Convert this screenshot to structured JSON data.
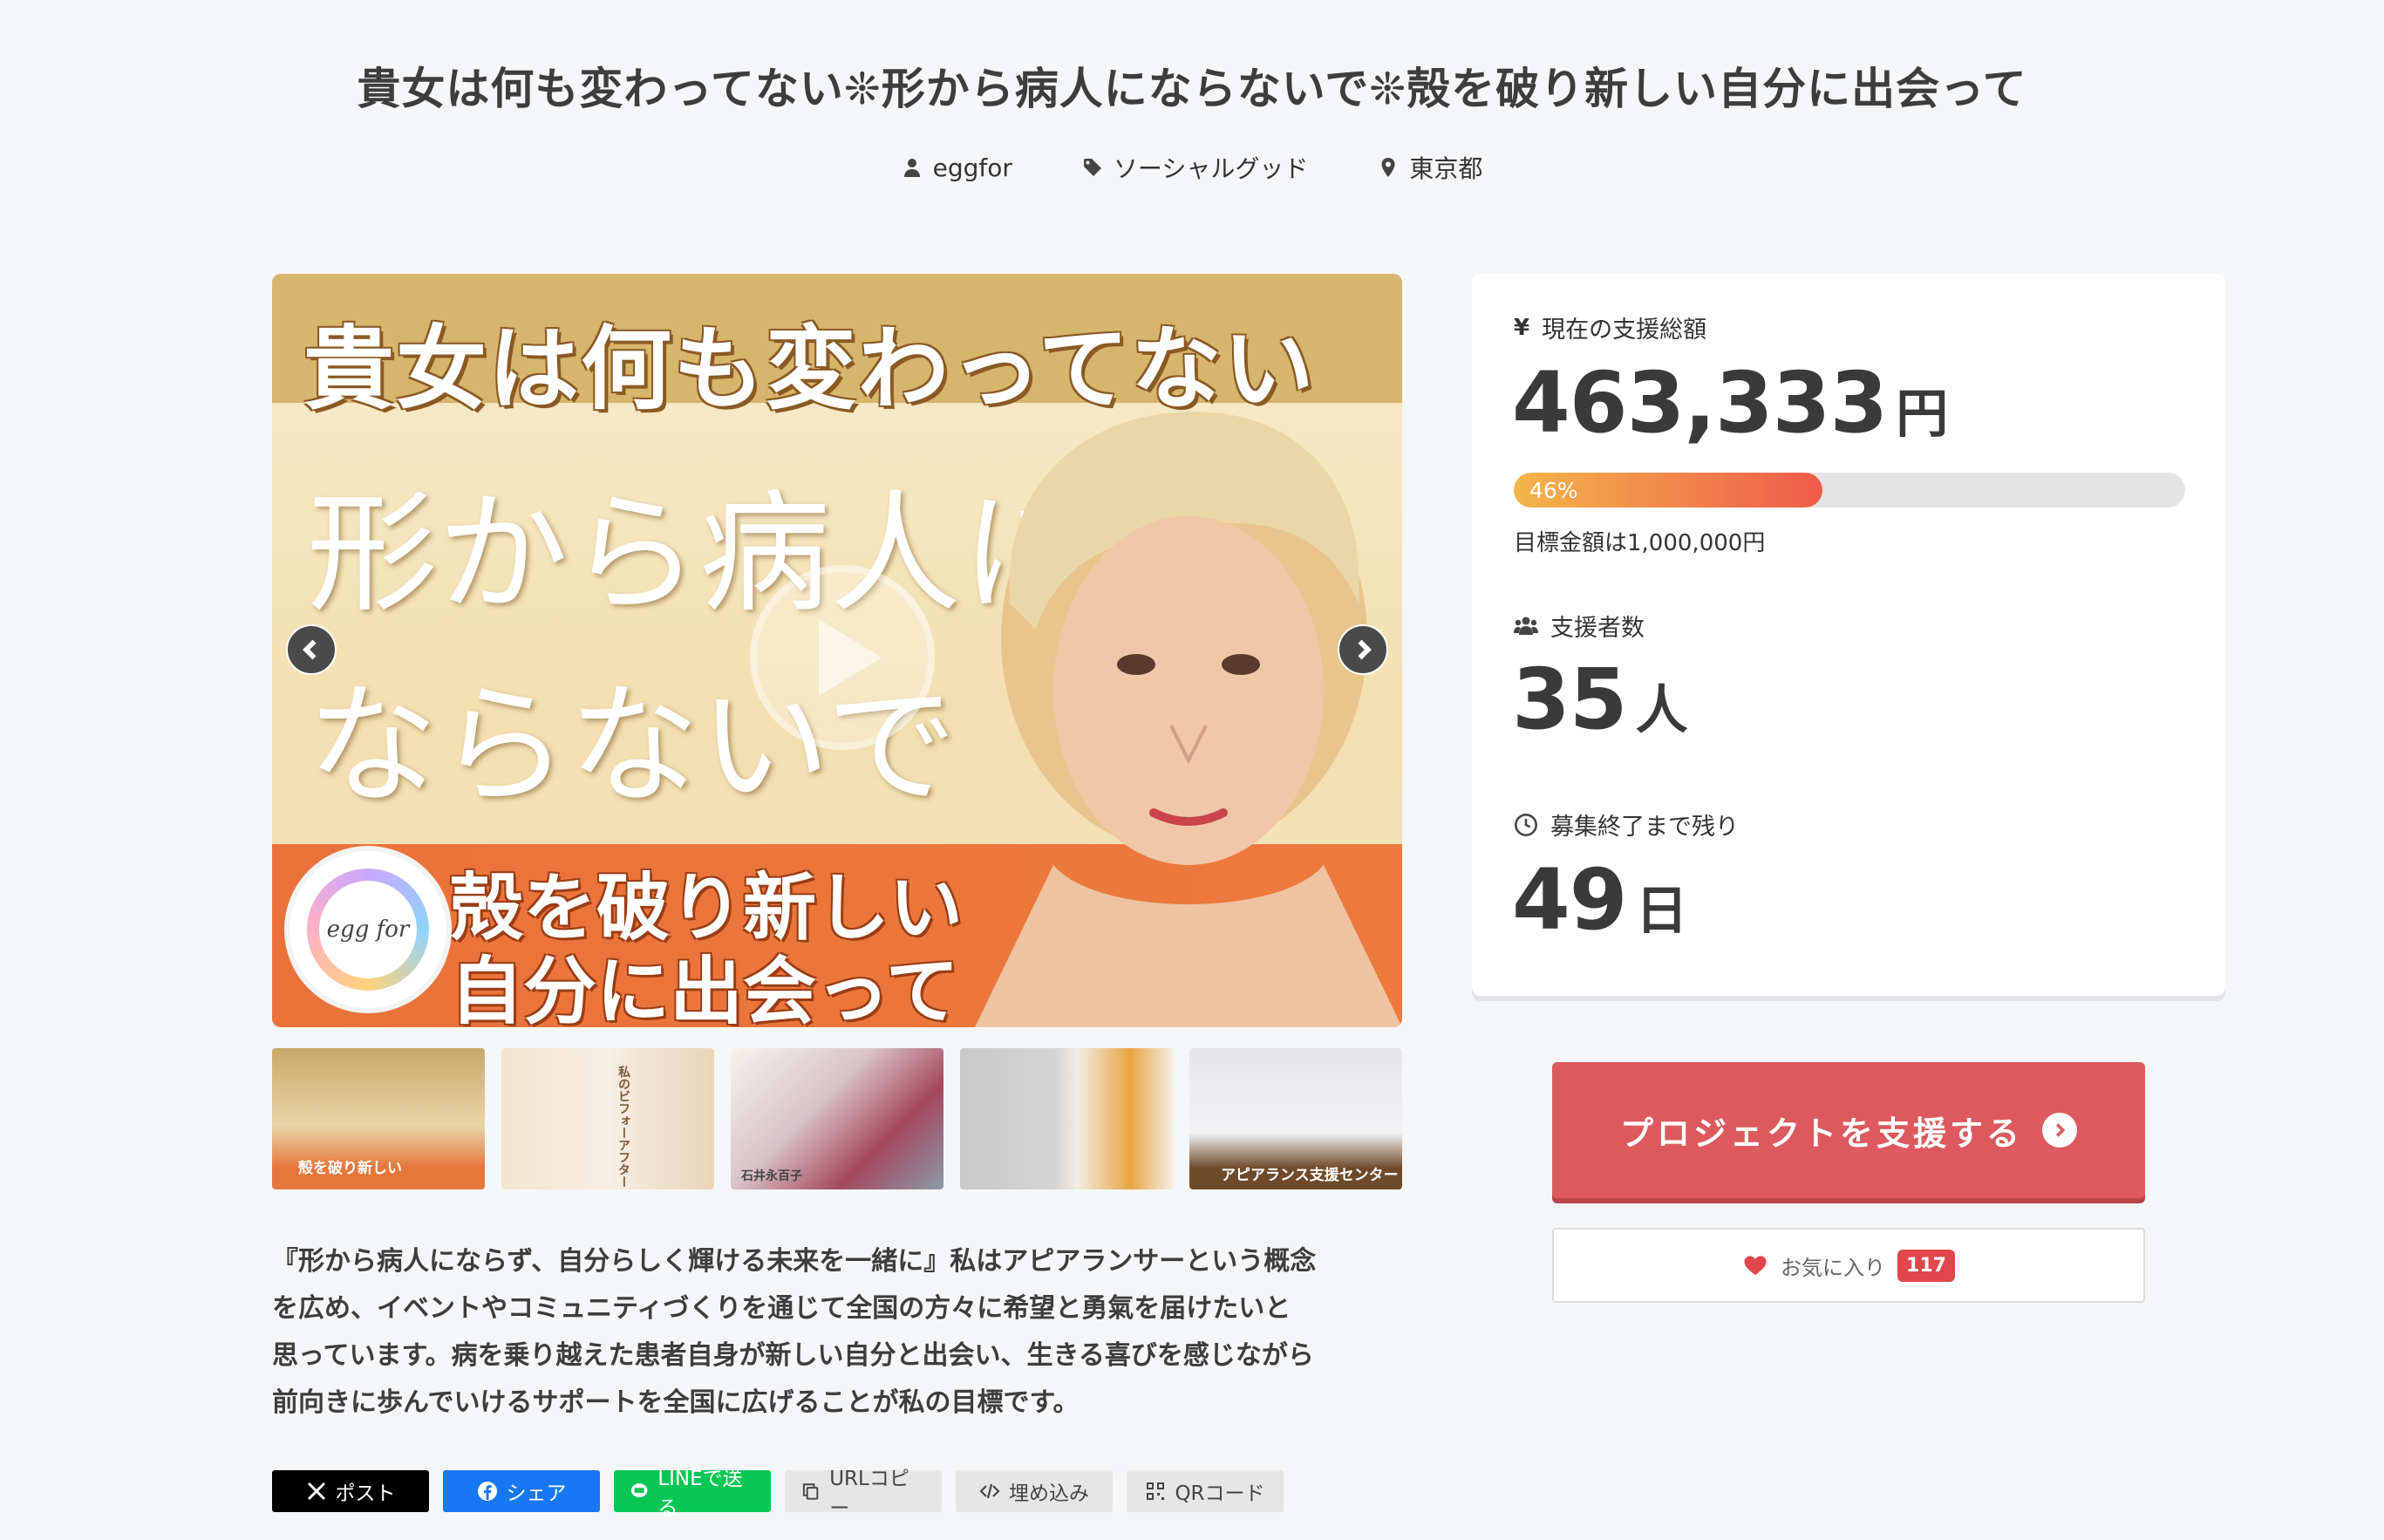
{
  "project": {
    "title": "貴女は何も変わってない❊形から病人にならないで❊殻を破り新しい自分に出会って",
    "owner": "eggfor",
    "category": "ソーシャルグッド",
    "location": "東京都",
    "description": [
      "『形から病人にならず、自分らしく輝ける未来を一緒に』私はアピアランサーという概念",
      "を広め、イベントやコミュニティづくりを通じて全国の方々に希望と勇氣を届けたいと",
      "思っています。病を乗り越えた患者自身が新しい自分と出会い、生きる喜びを感じながら",
      "前向きに歩んでいけるサポートを全国に広げることが私の目標です。"
    ]
  },
  "main_visual": {
    "top_text": "貴女は何も変わってない",
    "line1": "形から病人に",
    "line2": "ならないで",
    "bottom_line1": "殻を破り新しい",
    "bottom_line2": "自分に出会って",
    "logo_text": "egg for"
  },
  "thumbnails": [
    {
      "label": "殻を破り新しい"
    },
    {
      "label": "私のビフォーアフター"
    },
    {
      "label": "石井永百子"
    },
    {
      "label": ""
    },
    {
      "label": "アピアランス支援センター"
    }
  ],
  "stats": {
    "amount_label": "現在の支援総額",
    "amount": "463,333",
    "amount_unit": "円",
    "progress": 0.46,
    "progress_text": "46%",
    "goal_text": "目標金額は1,000,000円",
    "supporters_label": "支援者数",
    "supporters": "35",
    "supporters_unit": "人",
    "remaining_label": "募集終了まで残り",
    "remaining": "49",
    "remaining_unit": "日"
  },
  "actions": {
    "support_label": "プロジェクトを支援する",
    "favorite_label": "お気に入り",
    "favorite_count": "117"
  },
  "share": {
    "x": "ポスト",
    "facebook": "シェア",
    "line": "LINEで送る",
    "url": "URLコピー",
    "embed": "埋め込み",
    "qr": "QRコード"
  },
  "colors": {
    "accent": "#dc5a5f",
    "x": "#000000",
    "facebook": "#1877f2",
    "line": "#06c755",
    "neutral_btn": "#e6e6e6"
  }
}
